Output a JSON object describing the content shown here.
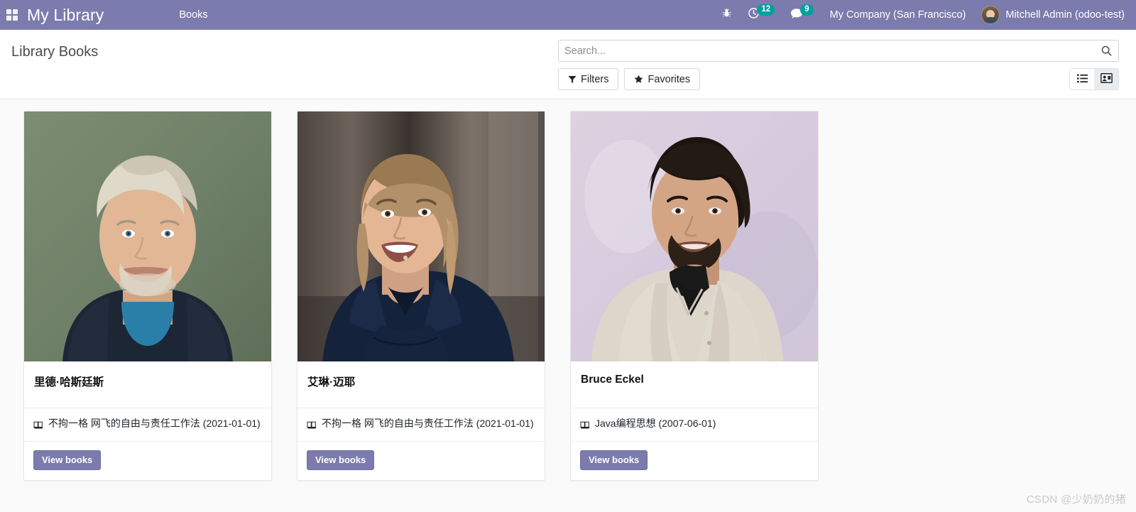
{
  "navbar": {
    "apps_menu_icon": "apps-grid-icon",
    "brand": "My Library",
    "menu": "Books",
    "debug_icon": "bug-icon",
    "activities": {
      "icon": "clock-icon",
      "count": "12"
    },
    "messages": {
      "icon": "chat-bubble-icon",
      "count": "9"
    },
    "company": "My Company (San Francisco)",
    "user": "Mitchell Admin (odoo-test)",
    "avatar_icon": "user-avatar",
    "accent_color": "#7c7bad",
    "badge_color": "#00a09d"
  },
  "control_panel": {
    "breadcrumb": "Library Books",
    "search": {
      "placeholder": "Search...",
      "value": "",
      "icon": "search-icon"
    },
    "filters_button": {
      "label": "Filters",
      "icon": "funnel-icon"
    },
    "favorites_button": {
      "label": "Favorites",
      "icon": "star-icon"
    },
    "view_switcher": [
      {
        "name": "list",
        "icon": "list-view-icon",
        "active": false
      },
      {
        "name": "kanban",
        "icon": "card-view-icon",
        "active": true
      }
    ]
  },
  "kanban": {
    "cards": [
      {
        "name": "里德·哈斯廷斯",
        "photo_alt": "portrait-reed-hastings",
        "books": [
          {
            "icon": "book-icon",
            "text": "不拘一格 网飞的自由与责任工作法 (2021-01-01)"
          }
        ],
        "action_label": "View books"
      },
      {
        "name": "艾琳·迈耶",
        "photo_alt": "portrait-erin-meyer",
        "books": [
          {
            "icon": "book-icon",
            "text": "不拘一格 网飞的自由与责任工作法 (2021-01-01)"
          }
        ],
        "action_label": "View books"
      },
      {
        "name": "Bruce Eckel",
        "photo_alt": "portrait-bruce-eckel",
        "books": [
          {
            "icon": "book-icon",
            "text": "Java编程思想 (2007-06-01)"
          }
        ],
        "action_label": "View books"
      }
    ]
  },
  "watermark": "CSDN @少奶奶的猪"
}
